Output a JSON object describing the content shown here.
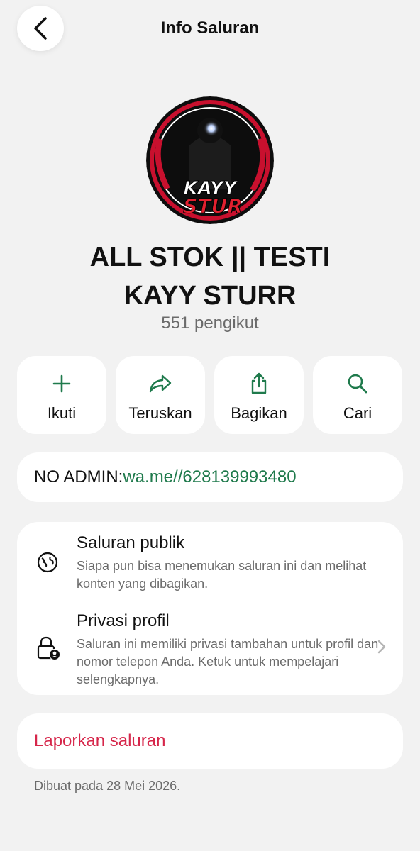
{
  "header": {
    "title": "Info Saluran",
    "back_icon": "chevron-left-icon"
  },
  "channel": {
    "avatar_text_top": "KAYY",
    "avatar_text_bottom": "STUR",
    "name_line1": "ALL STOK || TESTI",
    "name_line2": "KAYY STURR",
    "followers": "551 pengikut"
  },
  "actions": [
    {
      "label": "Ikuti",
      "icon": "plus-icon"
    },
    {
      "label": "Teruskan",
      "icon": "forward-arrow-icon"
    },
    {
      "label": "Bagikan",
      "icon": "share-icon"
    },
    {
      "label": "Cari",
      "icon": "search-icon"
    }
  ],
  "description": {
    "prefix": "NO ADMIN:",
    "link": "wa.me//628139993480"
  },
  "privacy": {
    "public_title": "Saluran publik",
    "public_sub": "Siapa pun bisa menemukan saluran ini dan melihat konten yang dibagikan.",
    "profile_title": "Privasi profil",
    "profile_sub": "Saluran ini memiliki privasi tambahan untuk profil dan nomor telepon Anda. Ketuk untuk mempelajari selengkapnya."
  },
  "report_label": "Laporkan saluran",
  "created_text": "Dibuat pada 28 Mei 2026.",
  "colors": {
    "accent_green": "#1f7a4c",
    "danger_red": "#d6264a",
    "background": "#f2f2f2"
  }
}
